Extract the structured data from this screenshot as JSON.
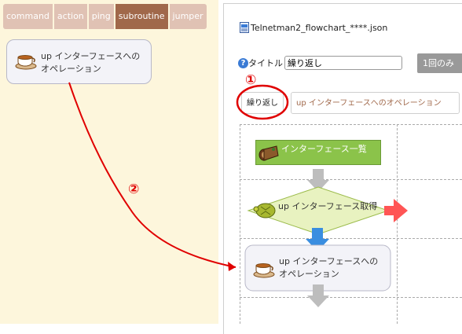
{
  "left": {
    "tabs": [
      {
        "label": "command"
      },
      {
        "label": "action"
      },
      {
        "label": "ping"
      },
      {
        "label": "subroutine",
        "active": true
      },
      {
        "label": "jumper"
      }
    ],
    "node": {
      "line1": "up インターフェースへの",
      "line2": "オペレーション"
    }
  },
  "right": {
    "file_name": "Telnetman2_flowchart_****.json",
    "title_label": "タイトル",
    "title_value": "繰り返し",
    "once_button": "1回のみ",
    "tag_repeat": "繰り返し",
    "tag_subroutine": "up インターフェースへのオペレーション",
    "flow": {
      "node1": "インターフェース一覧",
      "node2": "up インターフェース取得",
      "node3_line1": "up インターフェースへの",
      "node3_line2": "オペレーション"
    }
  },
  "annotations": {
    "marker1": "①",
    "marker2": "②",
    "color": "#e00000"
  }
}
